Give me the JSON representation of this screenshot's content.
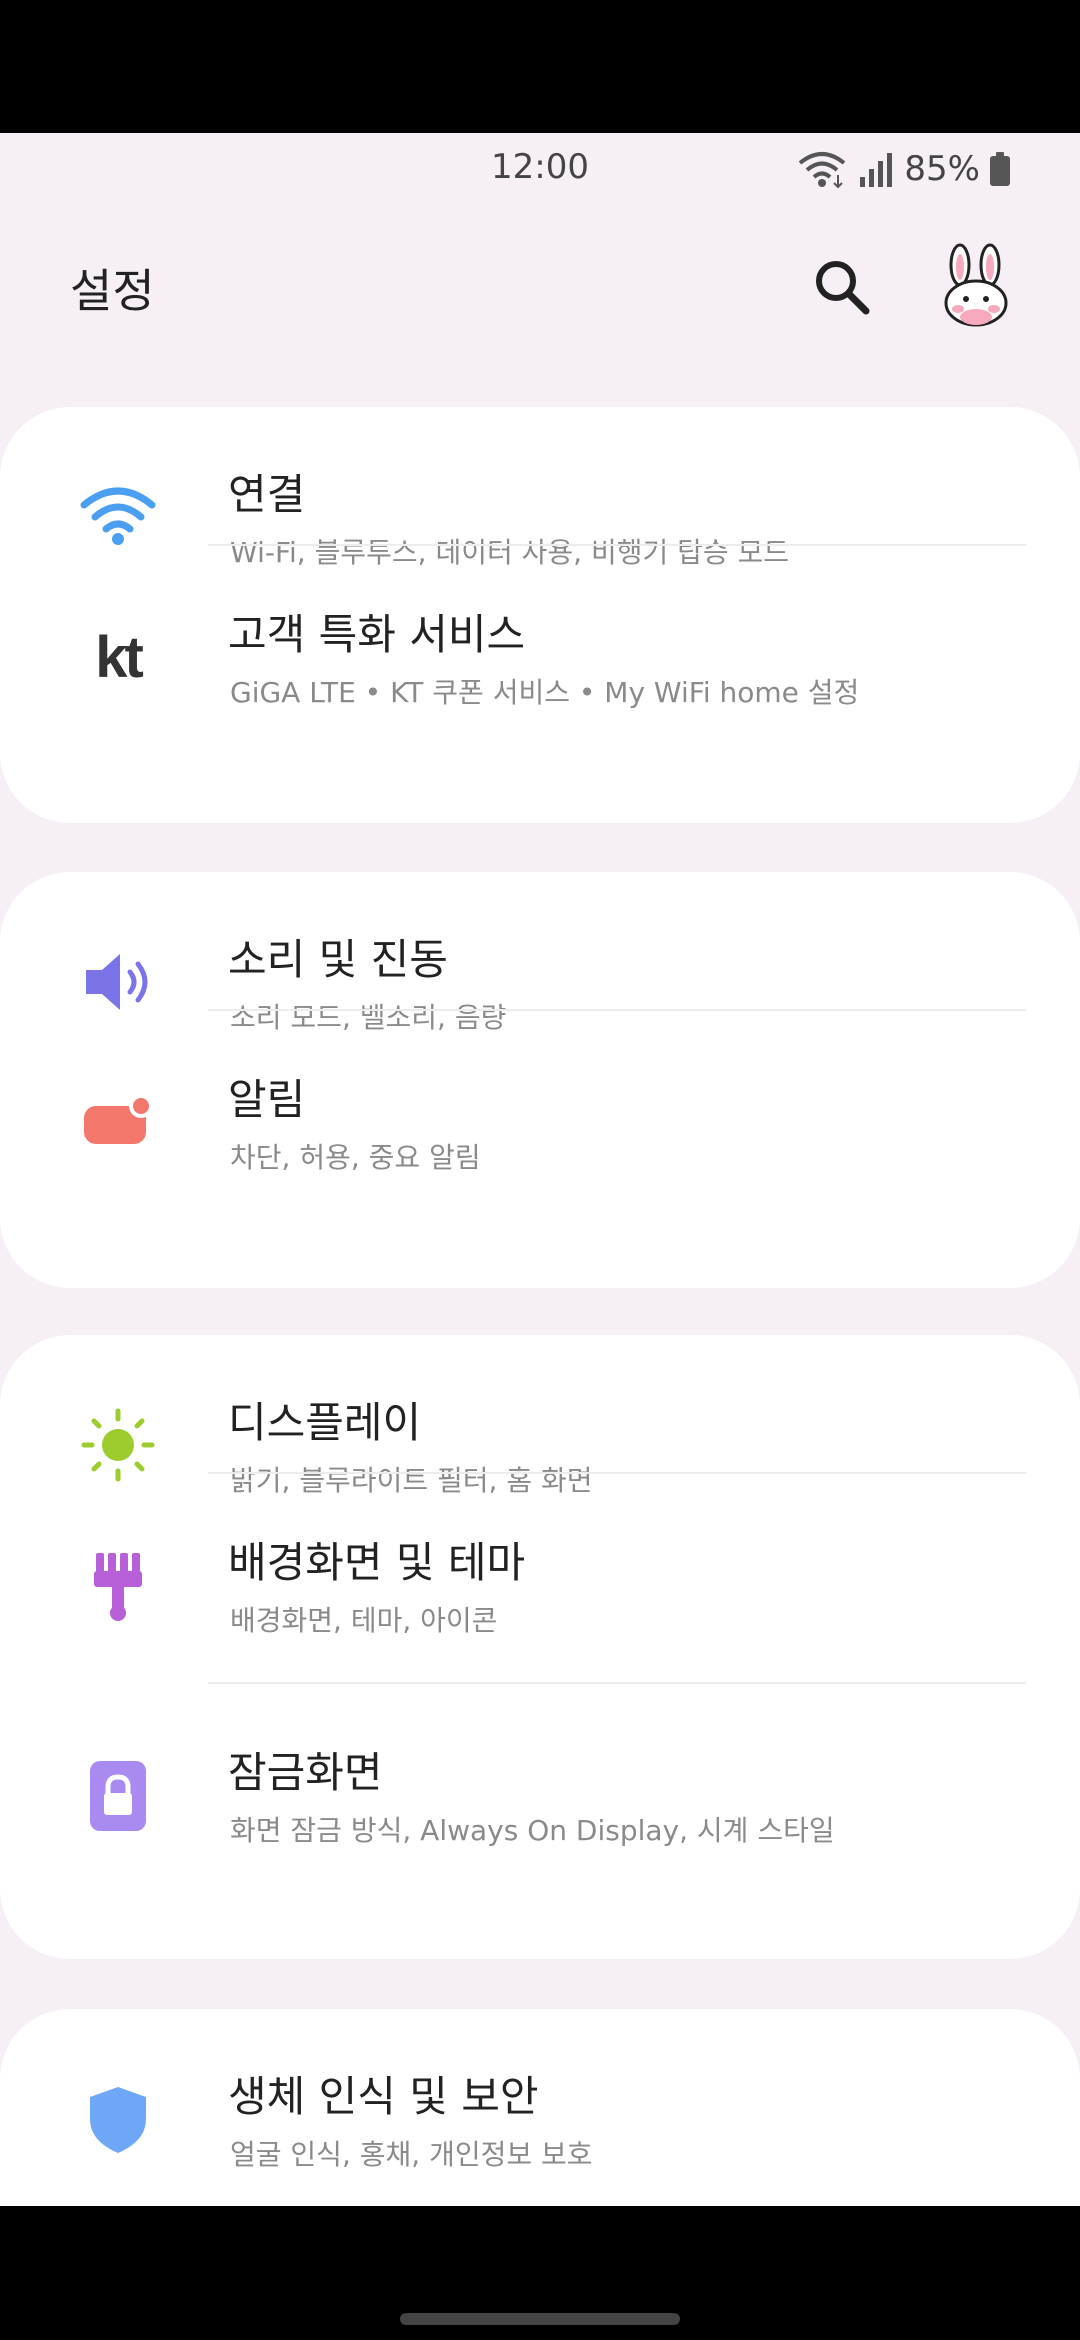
{
  "status_bar": {
    "time": "12:00",
    "battery_percent": "85%"
  },
  "header": {
    "title": "설정"
  },
  "icons": {
    "search": "search-icon",
    "avatar": "bunny-avatar"
  },
  "cards": [
    {
      "items": [
        {
          "title": "연결",
          "subtitle": "Wi-Fi, 블루투스, 데이터 사용, 비행기 탑승 모드",
          "icon": "wifi-icon",
          "color": "#4a9ff0"
        },
        {
          "title": "고객 특화 서비스",
          "subtitle": "GiGA LTE • KT 쿠폰 서비스 • My WiFi home 설정",
          "icon": "kt-logo-icon",
          "color": "#333333",
          "logo_text": "kt"
        }
      ]
    },
    {
      "items": [
        {
          "title": "소리 및 진동",
          "subtitle": "소리 모드, 벨소리, 음량",
          "icon": "speaker-icon",
          "color": "#7b74e8"
        },
        {
          "title": "알림",
          "subtitle": "차단, 허용, 중요 알림",
          "icon": "notification-icon",
          "color": "#f4776b"
        }
      ]
    },
    {
      "items": [
        {
          "title": "디스플레이",
          "subtitle": "밝기, 블루라이트 필터, 홈 화면",
          "icon": "brightness-icon",
          "color": "#9ccc2e"
        },
        {
          "title": "배경화면 및 테마",
          "subtitle": "배경화면, 테마, 아이콘",
          "icon": "paintbrush-icon",
          "color": "#b65fd6"
        },
        {
          "title": "잠금화면",
          "subtitle": "화면 잠금 방식, Always On Display, 시계 스타일",
          "icon": "lock-icon",
          "color": "#a98af0"
        }
      ]
    },
    {
      "items": [
        {
          "title": "생체 인식 및 보안",
          "subtitle": "얼굴 인식, 홍채, 개인정보 보호",
          "icon": "shield-icon",
          "color": "#6ea7f5"
        }
      ]
    }
  ]
}
